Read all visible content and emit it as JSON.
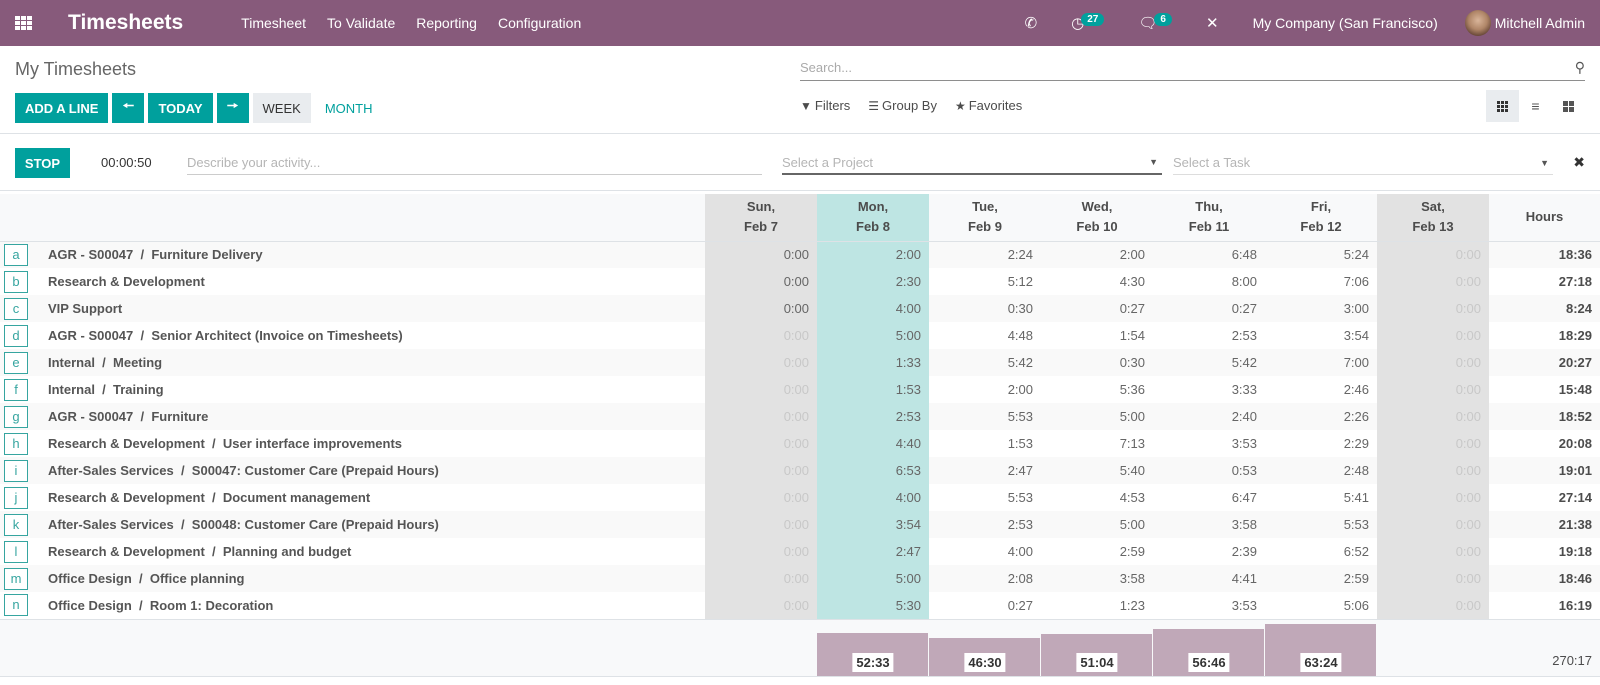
{
  "navbar": {
    "app_title": "Timesheets",
    "menu": [
      "Timesheet",
      "To Validate",
      "Reporting",
      "Configuration"
    ],
    "activity_badge": "27",
    "messages_badge": "6",
    "company": "My Company (San Francisco)",
    "user": "Mitchell Admin"
  },
  "control_panel": {
    "title": "My Timesheets",
    "add_line": "ADD A LINE",
    "today": "TODAY",
    "week": "WEEK",
    "month": "MONTH",
    "search_placeholder": "Search...",
    "filters": "Filters",
    "group_by": "Group By",
    "favorites": "Favorites"
  },
  "timer": {
    "stop": "STOP",
    "elapsed": "00:00:50",
    "activity_placeholder": "Describe your activity...",
    "project_placeholder": "Select a Project",
    "task_placeholder": "Select a Task"
  },
  "grid": {
    "columns": [
      {
        "day": "Sun,",
        "date": "Feb 7",
        "type": "weekend"
      },
      {
        "day": "Mon,",
        "date": "Feb 8",
        "type": "today"
      },
      {
        "day": "Tue,",
        "date": "Feb 9",
        "type": ""
      },
      {
        "day": "Wed,",
        "date": "Feb 10",
        "type": ""
      },
      {
        "day": "Thu,",
        "date": "Feb 11",
        "type": ""
      },
      {
        "day": "Fri,",
        "date": "Feb 12",
        "type": ""
      },
      {
        "day": "Sat,",
        "date": "Feb 13",
        "type": "weekend"
      }
    ],
    "hours_header": "Hours",
    "rows": [
      {
        "key": "a",
        "label": "AGR - S00047  /  Furniture Delivery",
        "values": [
          "0:00",
          "2:00",
          "2:24",
          "2:00",
          "6:48",
          "5:24",
          "0:00"
        ],
        "total": "18:36",
        "sun_active": true
      },
      {
        "key": "b",
        "label": "Research & Development",
        "values": [
          "0:00",
          "2:30",
          "5:12",
          "4:30",
          "8:00",
          "7:06",
          "0:00"
        ],
        "total": "27:18",
        "sun_active": true
      },
      {
        "key": "c",
        "label": "VIP Support",
        "values": [
          "0:00",
          "4:00",
          "0:30",
          "0:27",
          "0:27",
          "3:00",
          "0:00"
        ],
        "total": "8:24",
        "sun_active": true
      },
      {
        "key": "d",
        "label": "AGR - S00047  /  Senior Architect (Invoice on Timesheets)",
        "values": [
          "0:00",
          "5:00",
          "4:48",
          "1:54",
          "2:53",
          "3:54",
          "0:00"
        ],
        "total": "18:29",
        "sun_active": false
      },
      {
        "key": "e",
        "label": "Internal  /  Meeting",
        "values": [
          "0:00",
          "1:33",
          "5:42",
          "0:30",
          "5:42",
          "7:00",
          "0:00"
        ],
        "total": "20:27",
        "sun_active": false
      },
      {
        "key": "f",
        "label": "Internal  /  Training",
        "values": [
          "0:00",
          "1:53",
          "2:00",
          "5:36",
          "3:33",
          "2:46",
          "0:00"
        ],
        "total": "15:48",
        "sun_active": false
      },
      {
        "key": "g",
        "label": "AGR - S00047  /  Furniture",
        "values": [
          "0:00",
          "2:53",
          "5:53",
          "5:00",
          "2:40",
          "2:26",
          "0:00"
        ],
        "total": "18:52",
        "sun_active": false
      },
      {
        "key": "h",
        "label": "Research & Development  /  User interface improvements",
        "values": [
          "0:00",
          "4:40",
          "1:53",
          "7:13",
          "3:53",
          "2:29",
          "0:00"
        ],
        "total": "20:08",
        "sun_active": false
      },
      {
        "key": "i",
        "label": "After-Sales Services  /  S00047: Customer Care (Prepaid Hours)",
        "values": [
          "0:00",
          "6:53",
          "2:47",
          "5:40",
          "0:53",
          "2:48",
          "0:00"
        ],
        "total": "19:01",
        "sun_active": false
      },
      {
        "key": "j",
        "label": "Research & Development  /  Document management",
        "values": [
          "0:00",
          "4:00",
          "5:53",
          "4:53",
          "6:47",
          "5:41",
          "0:00"
        ],
        "total": "27:14",
        "sun_active": false
      },
      {
        "key": "k",
        "label": "After-Sales Services  /  S00048: Customer Care (Prepaid Hours)",
        "values": [
          "0:00",
          "3:54",
          "2:53",
          "5:00",
          "3:58",
          "5:53",
          "0:00"
        ],
        "total": "21:38",
        "sun_active": false
      },
      {
        "key": "l",
        "label": "Research & Development  /  Planning and budget",
        "values": [
          "0:00",
          "2:47",
          "4:00",
          "2:59",
          "2:39",
          "6:52",
          "0:00"
        ],
        "total": "19:18",
        "sun_active": false
      },
      {
        "key": "m",
        "label": "Office Design  /  Office planning",
        "values": [
          "0:00",
          "5:00",
          "2:08",
          "3:58",
          "4:41",
          "2:59",
          "0:00"
        ],
        "total": "18:46",
        "sun_active": false
      },
      {
        "key": "n",
        "label": "Office Design  /  Room 1: Decoration",
        "values": [
          "0:00",
          "5:30",
          "0:27",
          "1:23",
          "3:53",
          "5:06",
          "0:00"
        ],
        "total": "16:19",
        "sun_active": false
      }
    ],
    "footer_totals": [
      "",
      "52:33",
      "46:30",
      "51:04",
      "56:46",
      "63:24",
      ""
    ],
    "footer_hours": [
      0,
      52.55,
      46.5,
      51.07,
      56.77,
      63.4,
      0
    ],
    "grand_total": "270:17"
  }
}
